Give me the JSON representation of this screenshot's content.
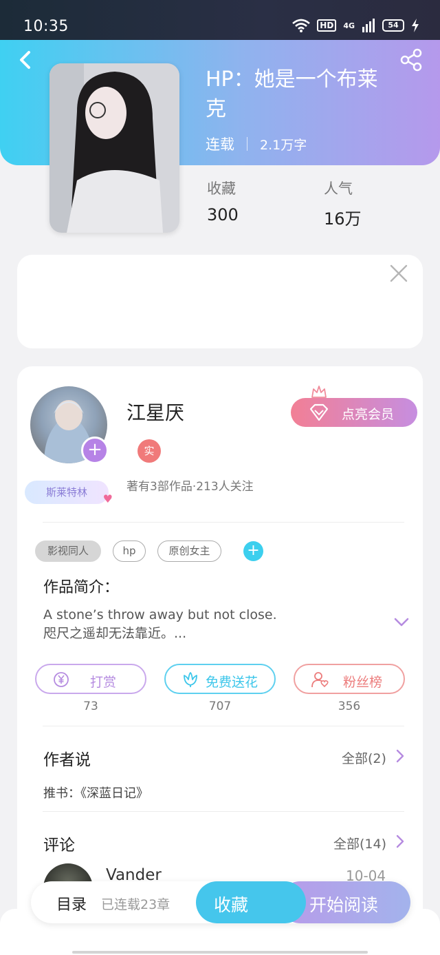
{
  "status_bar": {
    "time": "10:35",
    "hd": "HD",
    "network": "4G",
    "battery": "54"
  },
  "header": {
    "back_icon": "chevron-left-icon",
    "share_icon": "share-icon",
    "gradient_colors": [
      "#3fd0f2",
      "#8fb3ee",
      "#b599ec"
    ]
  },
  "book": {
    "title": "HP：她是一个布莱克",
    "status": "连载",
    "word_count": "2.1万字",
    "stats": [
      {
        "label": "收藏",
        "value": "300"
      },
      {
        "label": "人气",
        "value": "16万"
      }
    ]
  },
  "author": {
    "name": "江星厌",
    "real_badge": "实",
    "fan_badge": "斯莱特林",
    "summary": "著有3部作品·213人关注",
    "vip_button": "点亮会员"
  },
  "tags": [
    {
      "label": "影视同人",
      "style": "filled"
    },
    {
      "label": "hp",
      "style": "outline"
    },
    {
      "label": "原创女主",
      "style": "outline"
    }
  ],
  "intro": {
    "title": "作品简介：",
    "line1": "A stone’s throw away but not close.",
    "line2": "咫尺之遥却无法靠近。..."
  },
  "actions": [
    {
      "label": "打赏",
      "count": "73",
      "icon": "yen-coin-icon",
      "color": "#b58be0"
    },
    {
      "label": "免费送花",
      "count": "707",
      "icon": "flower-icon",
      "color": "#3cc6ea"
    },
    {
      "label": "粉丝榜",
      "count": "356",
      "icon": "user-heart-icon",
      "color": "#ec7c7c"
    }
  ],
  "author_says": {
    "title": "作者说",
    "more": "全部(2)",
    "content": "推书：《深蓝日记》"
  },
  "comments": {
    "title": "评论",
    "more": "全部(14)",
    "first": {
      "user": "Vander",
      "date": "10-04"
    }
  },
  "bottom": {
    "toc": "目录",
    "chapters": "已连载23章",
    "collect": "收藏",
    "read": "开始阅读"
  }
}
